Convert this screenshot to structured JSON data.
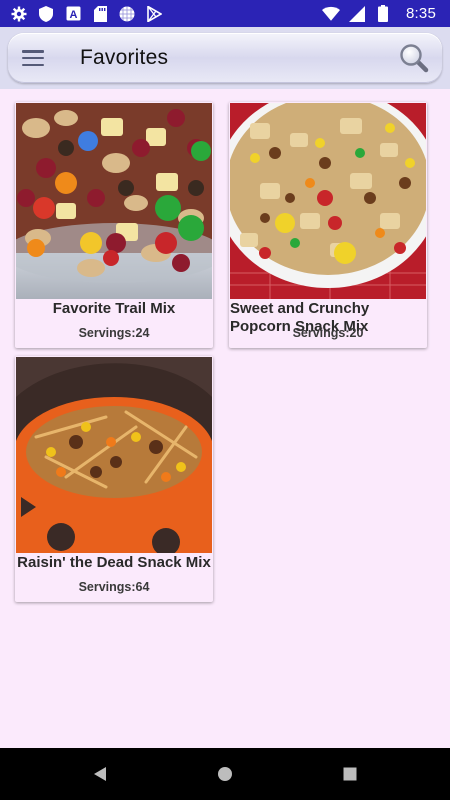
{
  "status_bar": {
    "time": "8:35",
    "left_icons": [
      "gear-icon",
      "shield-icon",
      "a-box-icon",
      "sd-card-icon",
      "circle-grid-icon",
      "play-store-icon"
    ],
    "right_icons": [
      "wifi-icon",
      "cellular-icon",
      "battery-icon"
    ]
  },
  "app_bar": {
    "title": "Favorites",
    "menu_icon": "hamburger-menu-icon",
    "search_icon": "search-icon"
  },
  "recipes": [
    {
      "name": "Favorite Trail Mix",
      "servings": "Servings:24"
    },
    {
      "name": "Sweet and Crunchy Popcorn Snack Mix",
      "servings": "Servings:20"
    },
    {
      "name": "Raisin' the Dead Snack Mix",
      "servings": "Servings:64"
    }
  ],
  "nav_bar": {
    "buttons": [
      "back-icon",
      "home-icon",
      "recents-icon"
    ]
  },
  "colors": {
    "status_bar": "#2b23b5",
    "background": "#fbeafc",
    "app_bar": "#e2e2f3",
    "nav_bar": "#000000"
  }
}
